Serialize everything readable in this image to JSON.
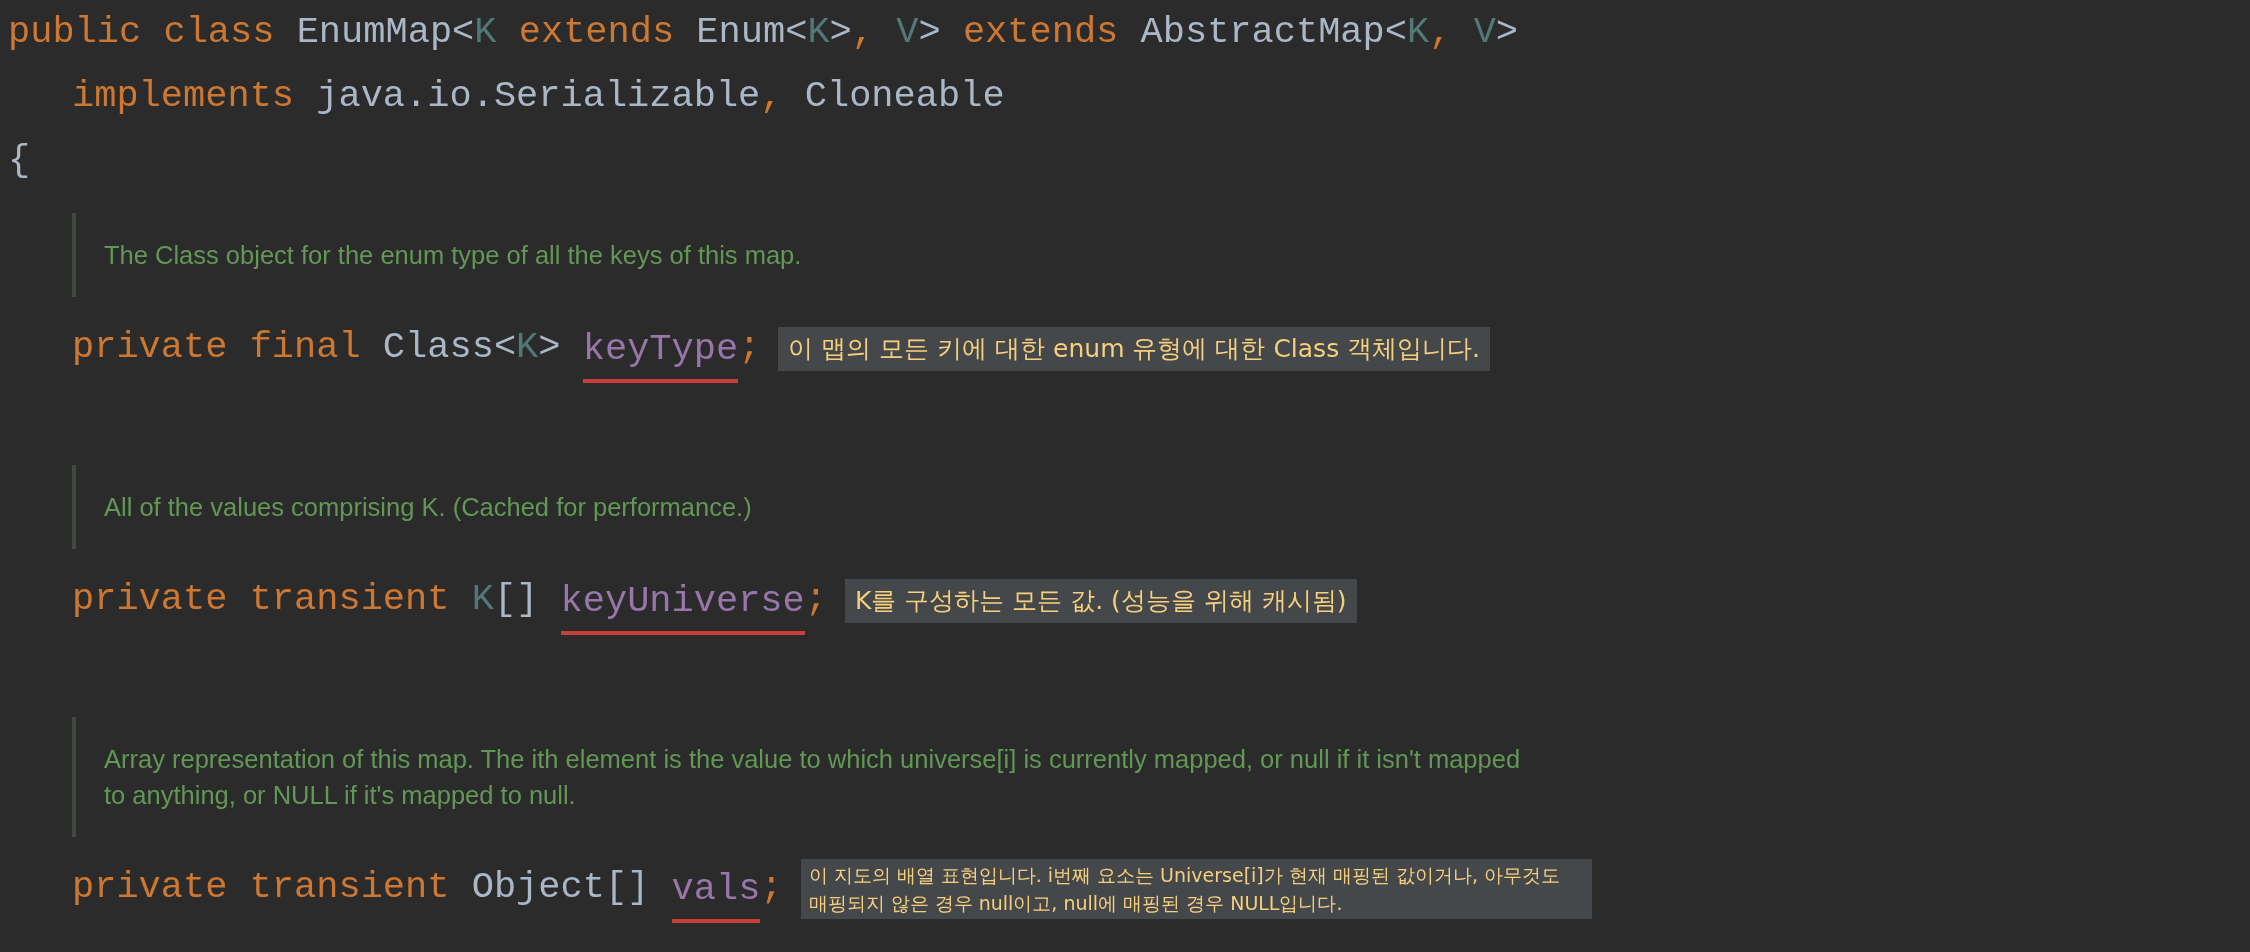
{
  "header_lines": [
    {
      "tokens": [
        {
          "text": "public class ",
          "kind": "keyword"
        },
        {
          "text": "EnumMap<",
          "kind": "plain"
        },
        {
          "text": "K",
          "kind": "type_param"
        },
        {
          "text": " extends ",
          "kind": "keyword"
        },
        {
          "text": "Enum<",
          "kind": "plain"
        },
        {
          "text": "K",
          "kind": "type_param"
        },
        {
          "text": ">",
          "kind": "plain"
        },
        {
          "text": ", ",
          "kind": "keyword"
        },
        {
          "text": "V",
          "kind": "type_param"
        },
        {
          "text": "> ",
          "kind": "plain"
        },
        {
          "text": "extends ",
          "kind": "keyword"
        },
        {
          "text": "AbstractMap<",
          "kind": "plain"
        },
        {
          "text": "K",
          "kind": "type_param"
        },
        {
          "text": ", ",
          "kind": "keyword"
        },
        {
          "text": "V",
          "kind": "type_param"
        },
        {
          "text": ">",
          "kind": "plain"
        }
      ],
      "children": [
        {
          "tokens": [
            {
              "text": "implements ",
              "kind": "keyword"
            },
            {
              "text": "java.io.Serializable",
              "kind": "plain"
            },
            {
              "text": ", ",
              "kind": "keyword"
            },
            {
              "text": "Cloneable",
              "kind": "plain"
            }
          ]
        }
      ]
    },
    {
      "tokens": [
        {
          "text": "{",
          "kind": "plain"
        }
      ]
    }
  ],
  "members": [
    {
      "doc": "The Class object for the enum type of all the keys of this map.",
      "declaration": [
        {
          "text": "private final ",
          "kind": "keyword"
        },
        {
          "text": "Class<",
          "kind": "plain"
        },
        {
          "text": "K",
          "kind": "type_param"
        },
        {
          "text": "> ",
          "kind": "plain"
        },
        {
          "text": "keyType",
          "kind": "field",
          "underlined": true
        },
        {
          "text": ";",
          "kind": "keyword"
        }
      ],
      "annotation": "이 맵의 모든 키에 대한 enum 유형에 대한 Class 객체입니다.",
      "kind": "large_tooltip"
    },
    {
      "doc": "All of the values comprising K. (Cached for performance.)",
      "declaration": [
        {
          "text": "private transient ",
          "kind": "keyword"
        },
        {
          "text": "K",
          "kind": "type_param"
        },
        {
          "text": "[] ",
          "kind": "plain"
        },
        {
          "text": "keyUniverse",
          "kind": "field",
          "underlined": true
        },
        {
          "text": ";",
          "kind": "keyword"
        }
      ],
      "annotation": "K를 구성하는 모든 값. (성능을 위해 캐시됨)",
      "kind": "large_tooltip"
    },
    {
      "doc": "Array representation of this map. The ith element is the value to which universe[i] is currently mapped, or null if it isn't mapped to anything, or NULL if it's mapped to null.",
      "declaration": [
        {
          "text": "private transient ",
          "kind": "keyword"
        },
        {
          "text": "Object[] ",
          "kind": "plain"
        },
        {
          "text": "vals",
          "kind": "field",
          "underlined": true
        },
        {
          "text": ";",
          "kind": "keyword"
        }
      ],
      "annotation": "이 지도의 배열 표현입니다. i번째 요소는 Universe[i]가 현재 매핑된 값이거나, 아무것도 매핑되지 않은 경우 null이고, null에 매핑된 경우 NULL입니다.",
      "kind": "small_tooltip"
    }
  ]
}
